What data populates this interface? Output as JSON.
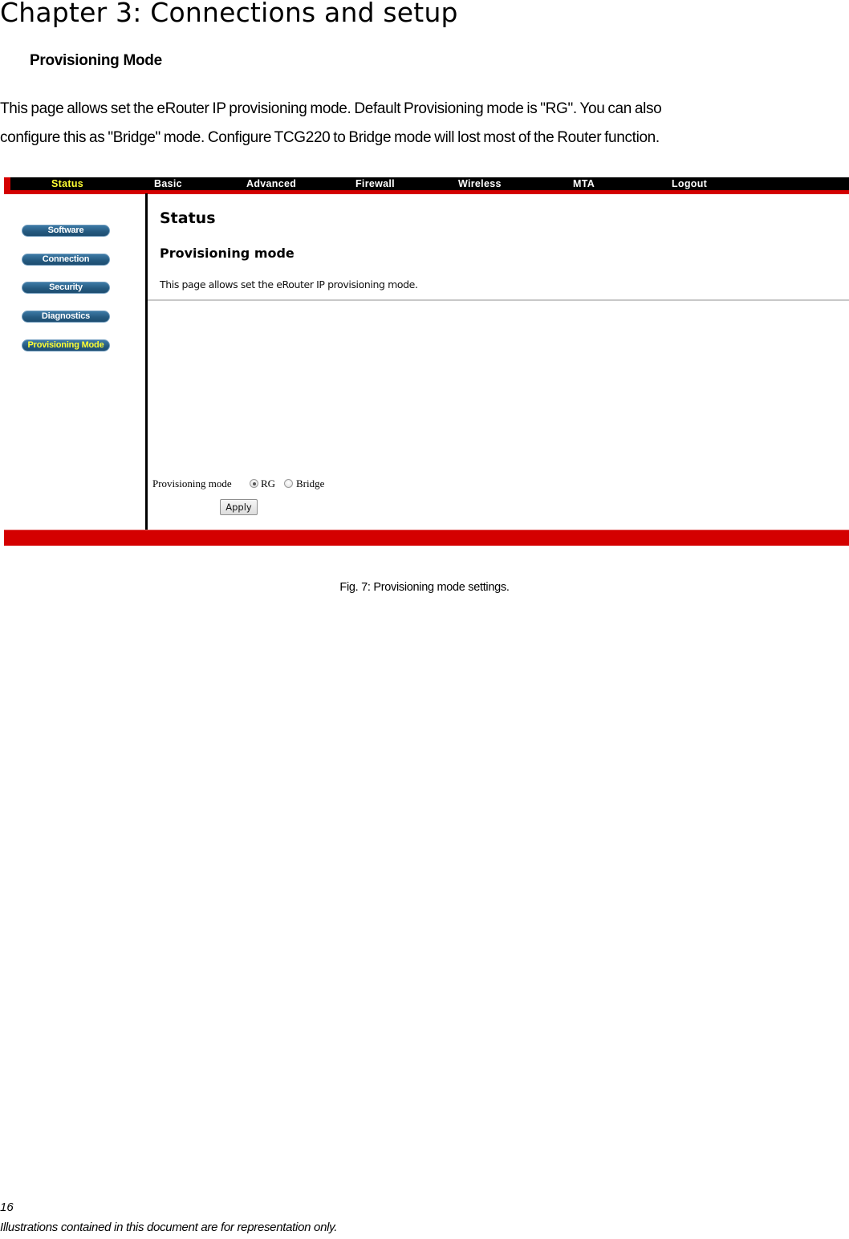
{
  "document": {
    "chapter_title": "Chapter 3: Connections and setup",
    "section_heading": "Provisioning Mode",
    "body_lines": [
      "This page allows set the eRouter IP provisioning mode. Default Provisioning mode is \"RG\". You can also",
      "configure this as \"Bridge\" mode. Configure TCG220 to Bridge mode will lost most of the Router function."
    ],
    "caption": "Fig. 7: Provisioning mode settings.",
    "page_number": "16",
    "footer_note": "Illustrations contained in this document are for representation only."
  },
  "router_ui": {
    "colors": {
      "nav_bg": "#000000",
      "brand_red": "#d40000",
      "active_text": "#ffff33",
      "sidebar_button": "#24597f"
    },
    "nav": {
      "items": [
        {
          "label": "Status",
          "active": true
        },
        {
          "label": "Basic",
          "active": false
        },
        {
          "label": "Advanced",
          "active": false
        },
        {
          "label": "Firewall",
          "active": false
        },
        {
          "label": "Wireless",
          "active": false
        },
        {
          "label": "MTA",
          "active": false
        },
        {
          "label": "Logout",
          "active": false
        }
      ]
    },
    "sidebar": {
      "items": [
        {
          "label": "Software",
          "active": false
        },
        {
          "label": "Connection",
          "active": false
        },
        {
          "label": "Security",
          "active": false
        },
        {
          "label": "Diagnostics",
          "active": false
        },
        {
          "label": "Provisioning Mode",
          "active": true
        }
      ]
    },
    "content": {
      "title": "Status",
      "subtitle": "Provisioning mode",
      "description": "This page allows set the eRouter IP provisioning mode."
    },
    "form": {
      "label": "Provisioning mode",
      "options": [
        {
          "label": "RG",
          "selected": true
        },
        {
          "label": "Bridge",
          "selected": false
        }
      ],
      "apply_label": "Apply"
    }
  }
}
